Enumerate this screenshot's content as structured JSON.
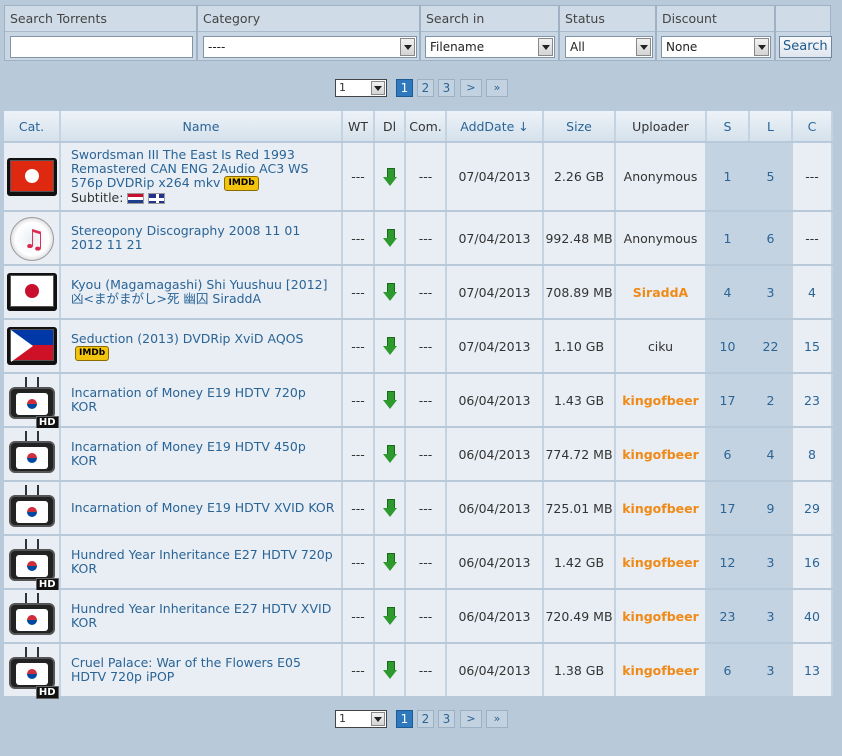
{
  "search": {
    "torrents_label": "Search Torrents",
    "torrents_value": "",
    "category_label": "Category",
    "category_value": "----",
    "searchin_label": "Search in",
    "searchin_value": "Filename",
    "status_label": "Status",
    "status_value": "All",
    "discount_label": "Discount",
    "discount_value": "None",
    "button_label": "Search"
  },
  "pager": {
    "select_value": "1",
    "pages": [
      "1",
      "2",
      "3"
    ],
    "next": ">",
    "last": "»"
  },
  "columns": [
    "Cat.",
    "Name",
    "WT",
    "Dl",
    "Com.",
    "AddDate ↓",
    "Size",
    "Uploader",
    "S",
    "L",
    "C"
  ],
  "subtitle_label": "Subtitle:",
  "imdb_label": "IMDb",
  "rows": [
    {
      "cat": "hongkong-flag-icon",
      "name": "Swordsman III The East Is Red 1993 Remastered CAN ENG 2Audio AC3 WS 576p DVDRip x264 mkv",
      "imdb": true,
      "subtitles": true,
      "wt": "---",
      "com": "---",
      "date": "07/04/2013",
      "size": "2.26 GB",
      "uploader": "Anonymous",
      "orange": false,
      "s": "1",
      "l": "5",
      "c": "---"
    },
    {
      "cat": "music-icon",
      "name": "Stereopony Discography 2008 11 01 2012 11 21",
      "imdb": false,
      "subtitles": false,
      "wt": "---",
      "com": "---",
      "date": "07/04/2013",
      "size": "992.48 MB",
      "uploader": "Anonymous",
      "orange": false,
      "s": "1",
      "l": "6",
      "c": "---"
    },
    {
      "cat": "japan-flag-icon",
      "name": "Kyou (Magamagashi) Shi Yuushuu [2012] 凶<まがまがし>死 幽囚 SiraddA",
      "imdb": false,
      "subtitles": false,
      "wt": "---",
      "com": "---",
      "date": "07/04/2013",
      "size": "708.89 MB",
      "uploader": "SiraddA",
      "orange": true,
      "s": "4",
      "l": "3",
      "c": "4"
    },
    {
      "cat": "philippines-flag-icon",
      "name": "Seduction (2013) DVDRip XviD AQOS",
      "imdb": true,
      "subtitles": false,
      "wt": "---",
      "com": "---",
      "date": "07/04/2013",
      "size": "1.10 GB",
      "uploader": "ciku",
      "orange": false,
      "s": "10",
      "l": "22",
      "c": "15"
    },
    {
      "cat": "korea-hd-tv-icon",
      "name": "Incarnation of Money E19 HDTV 720p KOR",
      "imdb": false,
      "subtitles": false,
      "wt": "---",
      "com": "---",
      "date": "06/04/2013",
      "size": "1.43 GB",
      "uploader": "kingofbeer",
      "orange": true,
      "s": "17",
      "l": "2",
      "c": "23"
    },
    {
      "cat": "korea-tv-icon",
      "name": "Incarnation of Money E19 HDTV 450p KOR",
      "imdb": false,
      "subtitles": false,
      "wt": "---",
      "com": "---",
      "date": "06/04/2013",
      "size": "774.72 MB",
      "uploader": "kingofbeer",
      "orange": true,
      "s": "6",
      "l": "4",
      "c": "8"
    },
    {
      "cat": "korea-tv-icon",
      "name": "Incarnation of Money E19 HDTV XVID KOR",
      "imdb": false,
      "subtitles": false,
      "wt": "---",
      "com": "---",
      "date": "06/04/2013",
      "size": "725.01 MB",
      "uploader": "kingofbeer",
      "orange": true,
      "s": "17",
      "l": "9",
      "c": "29"
    },
    {
      "cat": "korea-hd-tv-icon",
      "name": "Hundred Year Inheritance E27 HDTV 720p KOR",
      "imdb": false,
      "subtitles": false,
      "wt": "---",
      "com": "---",
      "date": "06/04/2013",
      "size": "1.42 GB",
      "uploader": "kingofbeer",
      "orange": true,
      "s": "12",
      "l": "3",
      "c": "16"
    },
    {
      "cat": "korea-tv-icon",
      "name": "Hundred Year Inheritance E27 HDTV XVID KOR",
      "imdb": false,
      "subtitles": false,
      "wt": "---",
      "com": "---",
      "date": "06/04/2013",
      "size": "720.49 MB",
      "uploader": "kingofbeer",
      "orange": true,
      "s": "23",
      "l": "3",
      "c": "40"
    },
    {
      "cat": "korea-hd-tv-icon",
      "name": "Cruel Palace: War of the Flowers E05 HDTV 720p iPOP",
      "imdb": false,
      "subtitles": false,
      "wt": "---",
      "com": "---",
      "date": "06/04/2013",
      "size": "1.38 GB",
      "uploader": "kingofbeer",
      "orange": true,
      "s": "6",
      "l": "3",
      "c": "13"
    }
  ]
}
